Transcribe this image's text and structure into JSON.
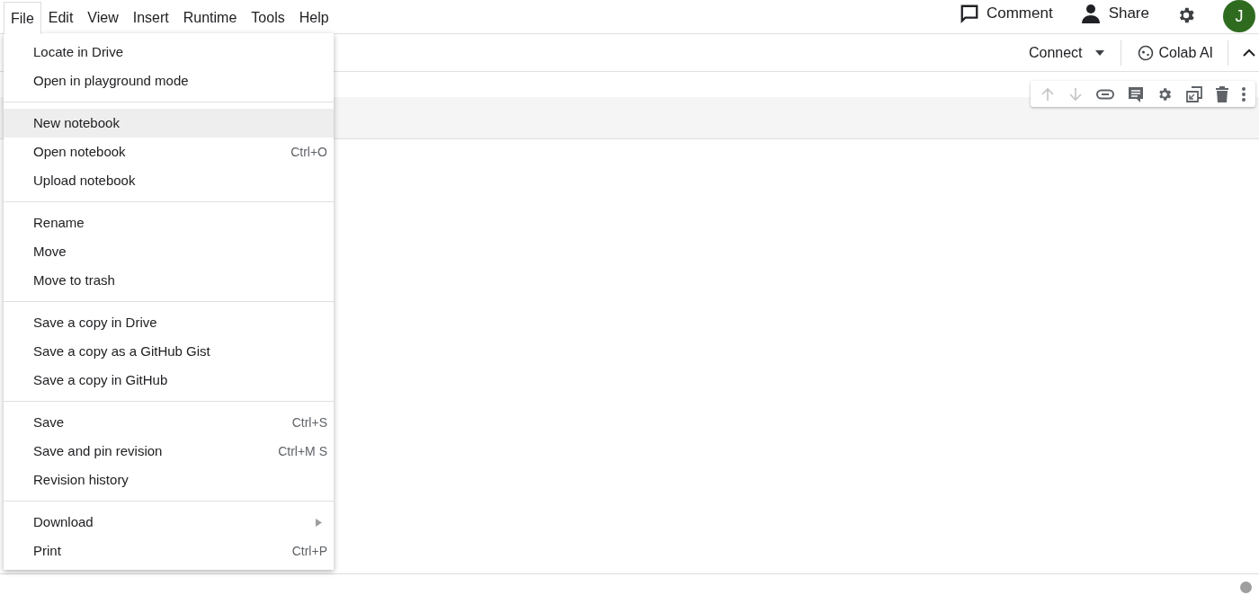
{
  "menu_bar": [
    {
      "label": "File",
      "selected": true
    },
    {
      "label": "Edit",
      "selected": false
    },
    {
      "label": "View",
      "selected": false
    },
    {
      "label": "Insert",
      "selected": false
    },
    {
      "label": "Runtime",
      "selected": false
    },
    {
      "label": "Tools",
      "selected": false
    },
    {
      "label": "Help",
      "selected": false
    }
  ],
  "header_actions": [
    "Comment",
    "Share"
  ],
  "toolbar": {
    "connect": "Connect",
    "colab_ai": "Colab AI"
  },
  "file_menu": {
    "groups": [
      [
        {
          "label": "Locate in Drive",
          "selected": false
        },
        {
          "label": "Open in playground mode",
          "selected": false
        }
      ],
      [
        {
          "label": "New notebook",
          "selected": true
        },
        {
          "label": "Open notebook",
          "shortcut": "Ctrl+O",
          "selected": false
        },
        {
          "label": "Upload notebook",
          "selected": false
        }
      ],
      [
        {
          "label": "Rename",
          "selected": false
        },
        {
          "label": "Move",
          "selected": false
        },
        {
          "label": "Move to trash",
          "selected": false
        }
      ],
      [
        {
          "label": "Save a copy in Drive",
          "selected": false
        },
        {
          "label": "Save a copy as a GitHub Gist",
          "selected": false
        },
        {
          "label": "Save a copy in GitHub",
          "selected": false
        }
      ],
      [
        {
          "label": "Save",
          "shortcut": "Ctrl+S",
          "selected": false
        },
        {
          "label": "Save and pin revision",
          "shortcut": "Ctrl+M S",
          "selected": false
        },
        {
          "label": "Revision history",
          "selected": false
        }
      ],
      [
        {
          "label": "Download",
          "submenu": true,
          "selected": false
        },
        {
          "label": "Print",
          "shortcut": "Ctrl+P",
          "selected": false
        }
      ]
    ]
  },
  "avatar": {
    "initial": "J"
  }
}
